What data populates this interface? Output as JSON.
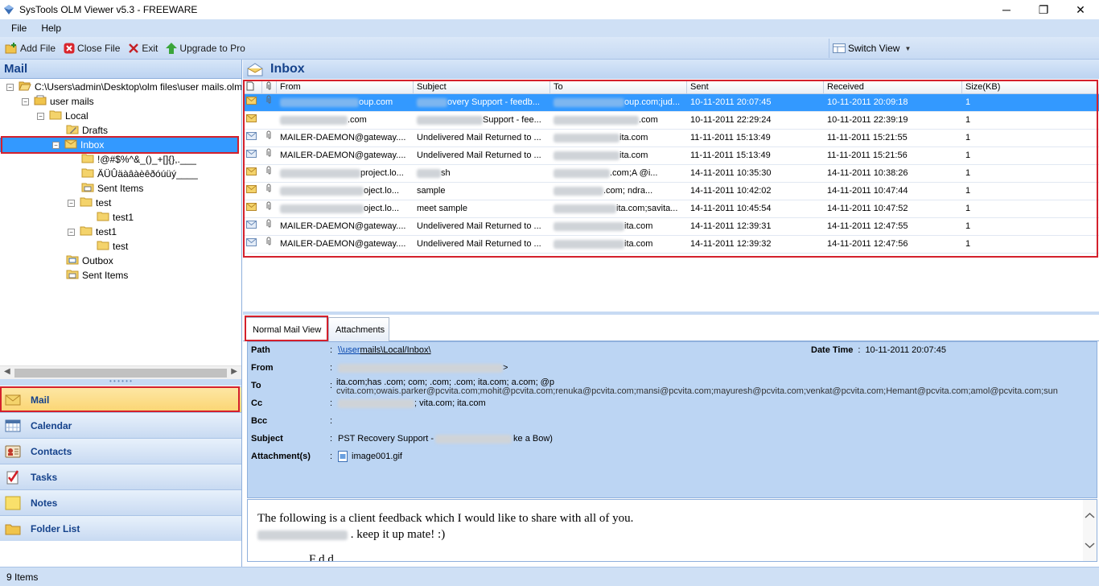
{
  "window": {
    "title": "SysTools OLM Viewer v5.3 - FREEWARE",
    "controls": [
      "─",
      "❐",
      "✕"
    ]
  },
  "menubar": [
    "File",
    "Help"
  ],
  "toolbar": {
    "add_file": "Add File",
    "close_file": "Close File",
    "exit": "Exit",
    "upgrade": "Upgrade to Pro",
    "switch_view": "Switch View"
  },
  "left_panel": {
    "header": "Mail",
    "tree": [
      {
        "label": "C:\\Users\\admin\\Desktop\\olm files\\user mails.olm",
        "depth": 0,
        "expander": "−",
        "icon": "folder-open-icon"
      },
      {
        "label": "user mails",
        "depth": 1,
        "expander": "−",
        "icon": "mailbox-icon"
      },
      {
        "label": "Local",
        "depth": 2,
        "expander": "−",
        "icon": "folder-icon"
      },
      {
        "label": "Drafts",
        "depth": 3,
        "expander": "",
        "icon": "drafts-icon"
      },
      {
        "label": "Inbox",
        "depth": 3,
        "expander": "−",
        "icon": "inbox-icon",
        "selected": true
      },
      {
        "label": "!@#$%^&_()_+[]{},.___",
        "depth": 4,
        "expander": "",
        "icon": "folder-icon"
      },
      {
        "label": "ÄÜÛäàâàèêðóúüý____",
        "depth": 4,
        "expander": "",
        "icon": "folder-icon"
      },
      {
        "label": "Sent Items",
        "depth": 4,
        "expander": "",
        "icon": "sent-icon"
      },
      {
        "label": "test",
        "depth": 4,
        "expander": "−",
        "icon": "folder-icon"
      },
      {
        "label": "test1",
        "depth": 5,
        "expander": "",
        "icon": "folder-icon"
      },
      {
        "label": "test1",
        "depth": 4,
        "expander": "−",
        "icon": "folder-icon"
      },
      {
        "label": "test",
        "depth": 5,
        "expander": "",
        "icon": "folder-icon"
      },
      {
        "label": "Outbox",
        "depth": 3,
        "expander": "",
        "icon": "outbox-icon"
      },
      {
        "label": "Sent Items",
        "depth": 3,
        "expander": "",
        "icon": "sent-icon"
      }
    ],
    "splitter_grip": "• • • • • •",
    "nav": [
      "Mail",
      "Calendar",
      "Contacts",
      "Tasks",
      "Notes",
      "Folder List"
    ]
  },
  "inbox": {
    "title": "Inbox",
    "columns": [
      "From",
      "Subject",
      "To",
      "Sent",
      "Received",
      "Size(KB)"
    ],
    "rows": [
      {
        "from": "oup.com",
        "subject": "overy Support - feedb...",
        "to": "oup.com;jud...",
        "sent": "10-11-2011 20:07:45",
        "received": "10-11-2011 20:09:18",
        "size": "1",
        "attach": true,
        "icon": "envelope-icon",
        "from_blur": 98,
        "subj_blur": 38,
        "to_blur": 88
      },
      {
        "from": ".com",
        "subject": "Support - fee...",
        "to": ".com",
        "sent": "10-11-2011 22:29:24",
        "received": "10-11-2011 22:39:19",
        "size": "1",
        "attach": false,
        "icon": "envelope-icon",
        "from_blur": 84,
        "subj_blur": 82,
        "to_blur": 106
      },
      {
        "from": "MAILER-DAEMON@gateway....",
        "subject": "Undelivered Mail Returned to ...",
        "to": "ita.com",
        "sent": "11-11-2011 15:13:49",
        "received": "11-11-2011 15:21:55",
        "size": "1",
        "attach": true,
        "icon": "returned-mail-icon",
        "from_blur": 0,
        "subj_blur": 0,
        "to_blur": 82
      },
      {
        "from": "MAILER-DAEMON@gateway....",
        "subject": "Undelivered Mail Returned to ...",
        "to": "ita.com",
        "sent": "11-11-2011 15:13:49",
        "received": "11-11-2011 15:21:56",
        "size": "1",
        "attach": true,
        "icon": "returned-mail-icon",
        "from_blur": 0,
        "subj_blur": 0,
        "to_blur": 82
      },
      {
        "from": "project.lo...",
        "subject": "sh",
        "to": ".com;A @i...",
        "sent": "14-11-2011 10:35:30",
        "received": "14-11-2011 10:38:26",
        "size": "1",
        "attach": true,
        "icon": "envelope-icon",
        "from_blur": 100,
        "subj_blur": 30,
        "to_blur": 70
      },
      {
        "from": "oject.lo...",
        "subject": "sample",
        "to": ".com; ndra...",
        "sent": "14-11-2011 10:42:02",
        "received": "14-11-2011 10:47:44",
        "size": "1",
        "attach": true,
        "icon": "envelope-icon",
        "from_blur": 104,
        "subj_blur": 0,
        "to_blur": 62
      },
      {
        "from": "oject.lo...",
        "subject": "meet sample",
        "to": "ita.com;savita...",
        "sent": "14-11-2011 10:45:54",
        "received": "14-11-2011 10:47:52",
        "size": "1",
        "attach": true,
        "icon": "envelope-icon",
        "from_blur": 104,
        "subj_blur": 0,
        "to_blur": 78
      },
      {
        "from": "MAILER-DAEMON@gateway....",
        "subject": "Undelivered Mail Returned to ...",
        "to": "ita.com",
        "sent": "14-11-2011 12:39:31",
        "received": "14-11-2011 12:47:55",
        "size": "1",
        "attach": true,
        "icon": "returned-mail-icon",
        "from_blur": 0,
        "subj_blur": 0,
        "to_blur": 88
      },
      {
        "from": "MAILER-DAEMON@gateway....",
        "subject": "Undelivered Mail Returned to ...",
        "to": "ita.com",
        "sent": "14-11-2011 12:39:32",
        "received": "14-11-2011 12:47:56",
        "size": "1",
        "attach": true,
        "icon": "returned-mail-icon",
        "from_blur": 0,
        "subj_blur": 0,
        "to_blur": 88
      }
    ]
  },
  "preview": {
    "tabs": [
      "Normal Mail View",
      "Attachments"
    ],
    "labels": {
      "path": "Path",
      "from": "From",
      "to": "To",
      "cc": "Cc",
      "bcc": "Bcc",
      "subject": "Subject",
      "attachments": "Attachment(s)",
      "date_time": "Date Time"
    },
    "path_link": "\\\\user",
    "path_rest": "mails\\Local/Inbox\\",
    "date_time": "10-11-2011 20:07:45",
    "from_tail": ">",
    "to_line1": "ita.com;has .com; com; .com; .com; ita.com; a.com; @p",
    "to_line2": "cvita.com;owais.parker@pcvita.com;mohit@pcvita.com;renuka@pcvita.com;mansi@pcvita.com;mayuresh@pcvita.com;venkat@pcvita.com;Hemant@pcvita.com;amol@pcvita.com;sun",
    "cc": "; vita.com; ita.com",
    "subject_start": "PST Recovery Support -",
    "subject_end": "ke a Bow)",
    "attachment": "image001.gif",
    "body_line1": "The following is a client feedback which I would like to share with all of you.",
    "body_line2": ". keep it up mate! :)",
    "body_line3": "F     d  d"
  },
  "status": "9 Items",
  "colors": {
    "accent": "#3399ff",
    "highlight_box": "#d4202c",
    "panel_blue": "#bcd5f3",
    "header_text": "#15428b"
  }
}
